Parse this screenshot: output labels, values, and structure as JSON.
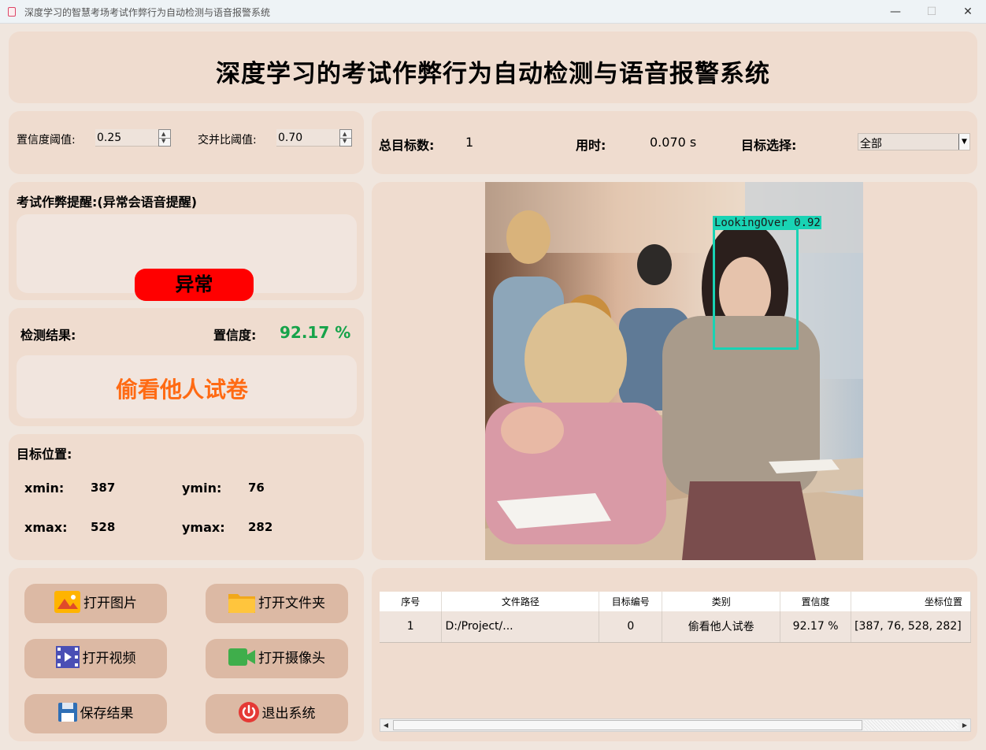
{
  "window": {
    "title": "深度学习的智慧考场考试作弊行为自动检测与语音报警系统",
    "min": "—",
    "max": "☐",
    "close": "✕"
  },
  "header": {
    "title": "深度学习的考试作弊行为自动检测与语音报警系统"
  },
  "params": {
    "conf_label": "置信度阈值:",
    "conf_value": "0.25",
    "iou_label": "交并比阈值:",
    "iou_value": "0.70"
  },
  "stats": {
    "total_label": "总目标数:",
    "total_value": "1",
    "time_label": "用时:",
    "time_value": "0.070 s",
    "select_label": "目标选择:",
    "select_value": "全部"
  },
  "alert": {
    "title": "考试作弊提醒:(异常会语音提醒)",
    "status": "异常",
    "status_color": "#ff0000"
  },
  "result": {
    "label": "检测结果:",
    "conf_label": "置信度:",
    "conf_value": "92.17 %",
    "conf_color": "#16a34a",
    "class_name": "偷看他人试卷",
    "class_color": "#ff6a13"
  },
  "position": {
    "title": "目标位置:",
    "xmin_label": "xmin:",
    "xmin": "387",
    "ymin_label": "ymin:",
    "ymin": "76",
    "xmax_label": "xmax:",
    "xmax": "528",
    "ymax_label": "ymax:",
    "ymax": "282"
  },
  "detection": {
    "label": "LookingOver 0.92",
    "box_color": "#19d3b4"
  },
  "buttons": {
    "open_image": "打开图片",
    "open_folder": "打开文件夹",
    "open_video": "打开视频",
    "open_camera": "打开摄像头",
    "save": "保存结果",
    "exit": "退出系统"
  },
  "table": {
    "headers": [
      "序号",
      "文件路径",
      "目标编号",
      "类别",
      "置信度",
      "坐标位置"
    ],
    "rows": [
      [
        "1",
        "D:/Project/...",
        "0",
        "偷看他人试卷",
        "92.17 %",
        "[387, 76, 528, 282]"
      ]
    ]
  },
  "icons": [
    "image-icon",
    "folder-icon",
    "video-icon",
    "camera-icon",
    "save-icon",
    "power-icon"
  ]
}
